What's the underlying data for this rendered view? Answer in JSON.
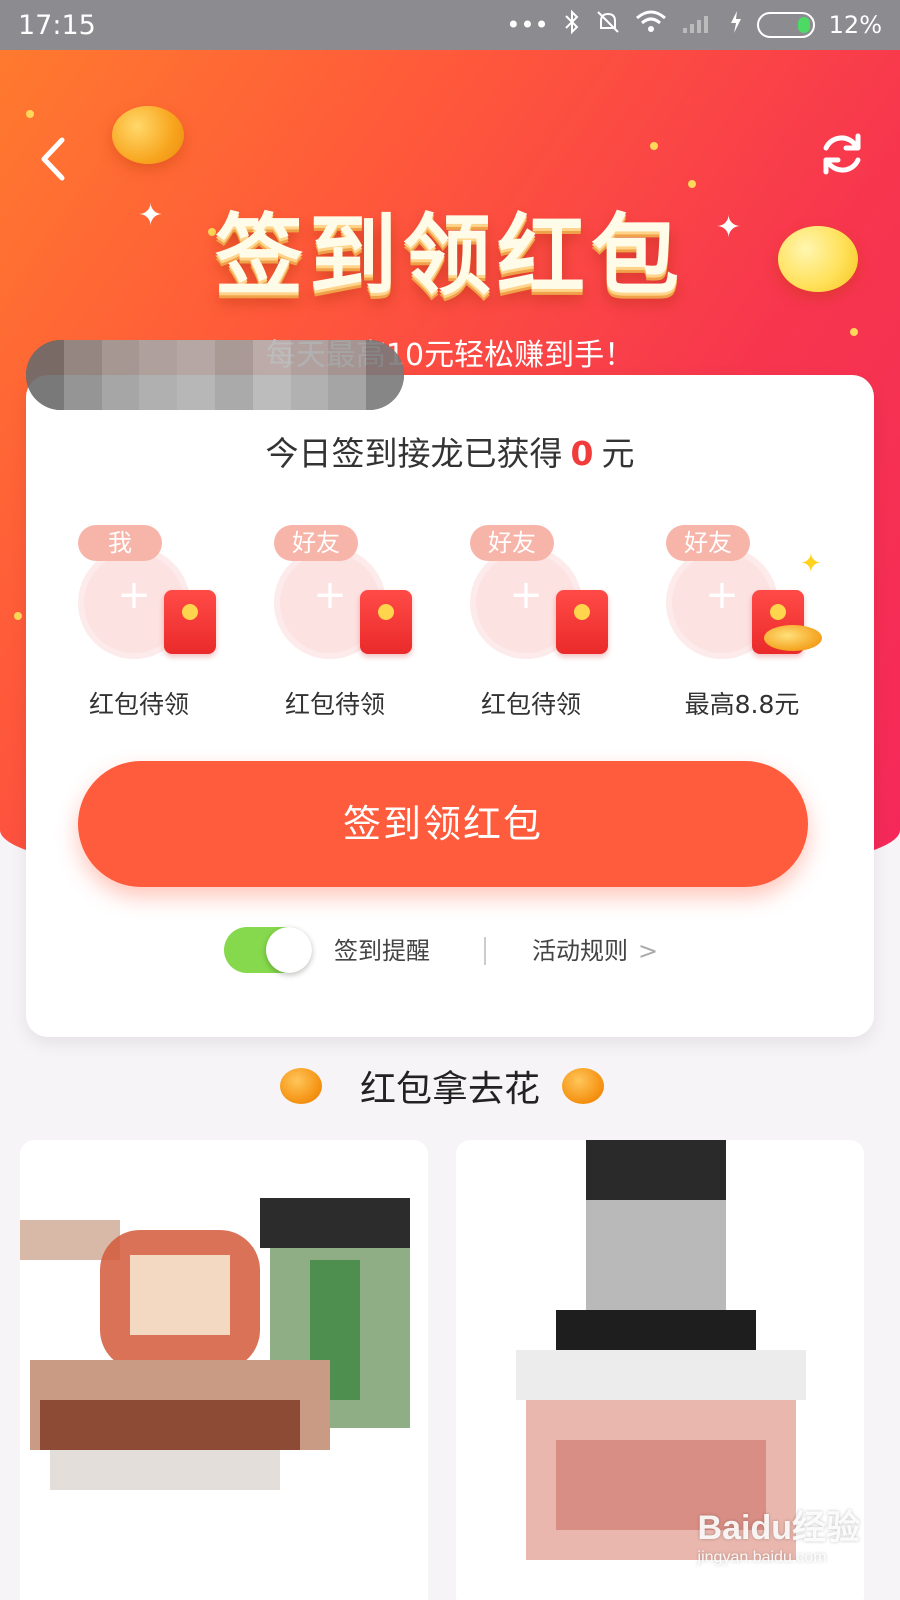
{
  "status_bar": {
    "time": "17:15",
    "icons": [
      "more-dots-icon",
      "bluetooth-icon",
      "bell-muted-icon",
      "wifi-icon",
      "signal-icon",
      "charging-icon",
      "battery-icon"
    ],
    "battery": "12%"
  },
  "header": {
    "title": "签到领红包",
    "subtitle": "每天最高10元轻松赚到手！",
    "back_icon": "chevron-left-icon",
    "refresh_icon": "refresh-icon"
  },
  "card": {
    "headline_prefix": "今日签到接龙已获得",
    "amount": "0",
    "headline_suffix": "元",
    "slots": [
      {
        "tag": "我",
        "label": "红包待领"
      },
      {
        "tag": "好友",
        "label": "红包待领"
      },
      {
        "tag": "好友",
        "label": "红包待领"
      },
      {
        "tag": "好友",
        "label": "最高8.8元"
      }
    ],
    "cta_label": "签到领红包",
    "reminder_label": "签到提醒",
    "reminder_on": true,
    "rules_label": "活动规则",
    "rules_chevron": ">"
  },
  "section": {
    "title": "红包拿去花"
  },
  "watermark": {
    "brand": "Baidu经验",
    "url": "jingyan.baidu.com"
  },
  "colors": {
    "accent": "#ff5b3d",
    "amount": "#f23b3b",
    "toggle_on": "#86d94c"
  }
}
